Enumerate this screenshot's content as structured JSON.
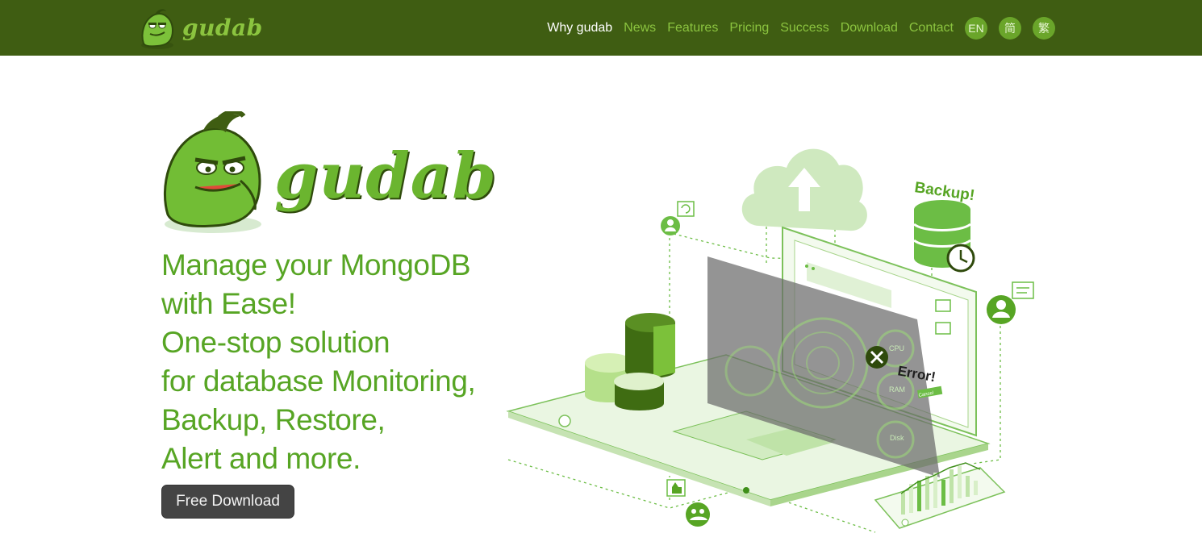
{
  "header": {
    "brand_name": "gudab",
    "nav": [
      "Why gudab",
      "News",
      "Features",
      "Pricing",
      "Success",
      "Download",
      "Contact"
    ],
    "languages": [
      "EN",
      "简",
      "繁"
    ]
  },
  "hero": {
    "brand_name": "gudab",
    "headline_lines": [
      "Manage your MongoDB",
      "with Ease!",
      "One-stop solution",
      "for database Monitoring,",
      "Backup, Restore,",
      "Alert and more."
    ],
    "cta_label": "Free Download"
  },
  "illustration": {
    "backup_label": "Backup!",
    "error_label": "Error!",
    "cpu_label": "CPU",
    "ram_label": "RAM",
    "disk_label": "Disk",
    "cancel_label": "Cancel"
  },
  "colors": {
    "header_bg": "#3f5d12",
    "accent": "#57a524",
    "nav_link": "#8bc43f",
    "cta_bg": "#444444"
  }
}
